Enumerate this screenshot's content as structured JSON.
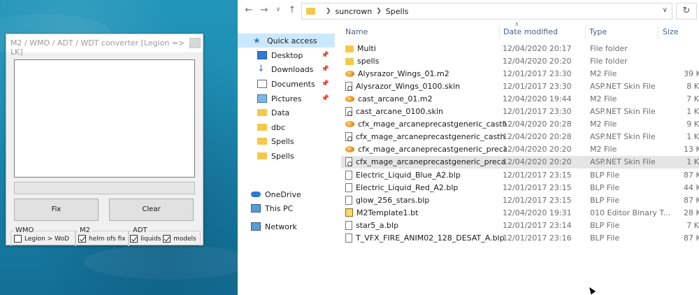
{
  "converter": {
    "title": "M2 / WMO / ADT / WDT converter  [Legion => LK]",
    "fix_label": "Fix",
    "clear_label": "Clear",
    "wmo_group": "WMO",
    "m2_group": "M2",
    "adt_group": "ADT",
    "legion_wod_label": "Legion > WoD",
    "legion_wod_checked": false,
    "helm_label": "helm ofs fix",
    "helm_checked": true,
    "liquids_label": "liquids",
    "liquids_checked": true,
    "models_label": "models",
    "models_checked": true
  },
  "explorer": {
    "breadcrumb": [
      "suncrown",
      "Spells"
    ],
    "columns": {
      "name": "Name",
      "date": "Date modified",
      "type": "Type",
      "size": "Size"
    },
    "sidebar": [
      {
        "label": "Quick access",
        "icon": "star-icon",
        "active": true,
        "pinned": false
      },
      {
        "label": "Desktop",
        "icon": "desktop-icon",
        "pinned": true
      },
      {
        "label": "Downloads",
        "icon": "download-icon",
        "pinned": true
      },
      {
        "label": "Documents",
        "icon": "documents-icon",
        "pinned": true
      },
      {
        "label": "Pictures",
        "icon": "pictures-icon",
        "pinned": true
      },
      {
        "label": "Data",
        "icon": "folder-icon",
        "pinned": false
      },
      {
        "label": "dbc",
        "icon": "folder-icon",
        "pinned": false
      },
      {
        "label": "Spells",
        "icon": "folder-icon",
        "pinned": false
      },
      {
        "label": "Spells",
        "icon": "folder-icon",
        "pinned": false
      },
      {
        "label": "OneDrive",
        "icon": "cloud-icon",
        "pinned": false
      },
      {
        "label": "This PC",
        "icon": "computer-icon",
        "pinned": false
      },
      {
        "label": "Network",
        "icon": "network-icon",
        "pinned": false
      }
    ],
    "files": [
      {
        "name": "Multi",
        "date": "12/04/2020 20:17",
        "type": "File folder",
        "size": "",
        "icon": "folder"
      },
      {
        "name": "spells",
        "date": "12/04/2020 20:20",
        "type": "File folder",
        "size": "",
        "icon": "folder"
      },
      {
        "name": "Alysrazor_Wings_01.m2",
        "date": "12/01/2017 23:30",
        "type": "M2 File",
        "size": "39 K",
        "icon": "m2"
      },
      {
        "name": "Alysrazor_Wings_0100.skin",
        "date": "12/01/2017 23:30",
        "type": "ASP.NET Skin File",
        "size": "8 K",
        "icon": "skin"
      },
      {
        "name": "cast_arcane_01.m2",
        "date": "12/04/2020 19:44",
        "type": "M2 File",
        "size": "7 K",
        "icon": "m2"
      },
      {
        "name": "cast_arcane_0100.skin",
        "date": "12/01/2017 23:30",
        "type": "ASP.NET Skin File",
        "size": "1 K",
        "icon": "skin"
      },
      {
        "name": "cfx_mage_arcaneprecastgeneric_casthan...",
        "date": "12/04/2020 20:28",
        "type": "M2 File",
        "size": "9 K",
        "icon": "m2"
      },
      {
        "name": "cfx_mage_arcaneprecastgeneric_casthan...",
        "date": "12/04/2020 20:28",
        "type": "ASP.NET Skin File",
        "size": "1 K",
        "icon": "skin"
      },
      {
        "name": "cfx_mage_arcaneprecastgeneric_precast...",
        "date": "12/04/2020 20:20",
        "type": "M2 File",
        "size": "13 K",
        "icon": "m2"
      },
      {
        "name": "cfx_mage_arcaneprecastgeneric_precast...",
        "date": "12/04/2020 20:20",
        "type": "ASP.NET Skin File",
        "size": "1 K",
        "icon": "skin",
        "selected": true
      },
      {
        "name": "Electric_Liquid_Blue_A2.blp",
        "date": "12/01/2017 23:15",
        "type": "BLP File",
        "size": "87 K",
        "icon": "file"
      },
      {
        "name": "Electric_Liquid_Red_A2.blp",
        "date": "12/01/2017 23:15",
        "type": "BLP File",
        "size": "44 K",
        "icon": "file"
      },
      {
        "name": "glow_256_stars.blp",
        "date": "12/01/2017 23:15",
        "type": "BLP File",
        "size": "87 K",
        "icon": "file"
      },
      {
        "name": "M2Template1.bt",
        "date": "12/04/2020 19:31",
        "type": "010 Editor Binary T...",
        "size": "28 K",
        "icon": "bt"
      },
      {
        "name": "star5_a.blp",
        "date": "12/01/2017 23:14",
        "type": "BLP File",
        "size": "7 K",
        "icon": "file"
      },
      {
        "name": "T_VFX_FIRE_ANIM02_128_DESAT_A.blp",
        "date": "12/01/2017 23:16",
        "type": "BLP File",
        "size": "87 K",
        "icon": "file"
      }
    ]
  }
}
